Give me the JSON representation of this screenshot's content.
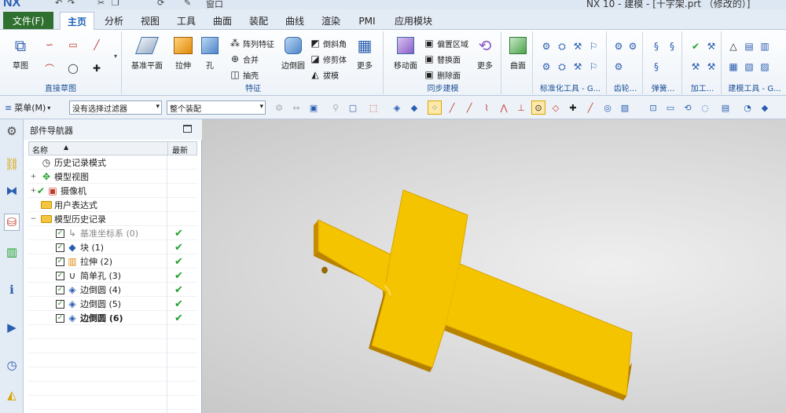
{
  "app": {
    "logo": "NX",
    "window_title": "NX 10 - 建模 - [十字架.prt （修改的）]",
    "window_menu": "窗口"
  },
  "tabs": [
    "文件(F)",
    "主页",
    "分析",
    "视图",
    "工具",
    "曲面",
    "装配",
    "曲线",
    "渲染",
    "PMI",
    "应用模块"
  ],
  "active_tab": "主页",
  "ribbon": {
    "sketch_group": {
      "label": "直接草图",
      "sketch_button": "草图"
    },
    "feature_group": {
      "label": "特征",
      "buttons": [
        "基准平面",
        "拉伸",
        "孔",
        "边倒圆",
        "更多"
      ],
      "small": [
        "阵列特征",
        "合并",
        "抽壳",
        "倒斜角",
        "修剪体",
        "拔模"
      ]
    },
    "sync_group": {
      "label": "同步建模",
      "buttons": [
        "移动面",
        "更多"
      ],
      "small": [
        "偏置区域",
        "替换面",
        "删除面"
      ]
    },
    "surface_button": "曲面",
    "more_groups": [
      "标准化工具 - G...",
      "齿轮...",
      "弹簧...",
      "加工...",
      "建模工具 - G..."
    ]
  },
  "filterbar": {
    "menu_label": "菜单(M)",
    "filter_value": "没有选择过滤器",
    "scope_value": "整个装配"
  },
  "navigator": {
    "title": "部件导航器",
    "col_name": "名称",
    "col_latest": "最新",
    "rows": [
      {
        "label": "历史记录模式",
        "indent": 0,
        "exp": "",
        "check": false,
        "icon": "clock-icon",
        "tick": false,
        "style": ""
      },
      {
        "label": "模型视图",
        "indent": 0,
        "exp": "+",
        "check": false,
        "icon": "model-view-icon",
        "tick": false,
        "style": ""
      },
      {
        "label": "摄像机",
        "indent": 0,
        "exp": "+",
        "check": false,
        "icon": "camera-icon",
        "tick": false,
        "style": ""
      },
      {
        "label": "用户表达式",
        "indent": 0,
        "exp": "",
        "check": false,
        "icon": "folder-icon",
        "tick": false,
        "style": ""
      },
      {
        "label": "模型历史记录",
        "indent": 0,
        "exp": "−",
        "check": false,
        "icon": "folder-open-icon",
        "tick": false,
        "style": ""
      },
      {
        "label": "基准坐标系 (0)",
        "indent": 1,
        "exp": "",
        "check": true,
        "icon": "datum-csys-icon",
        "tick": true,
        "style": "grey"
      },
      {
        "label": "块 (1)",
        "indent": 1,
        "exp": "",
        "check": true,
        "icon": "block-icon",
        "tick": true,
        "style": ""
      },
      {
        "label": "拉伸 (2)",
        "indent": 1,
        "exp": "",
        "check": true,
        "icon": "extrude-icon",
        "tick": true,
        "style": ""
      },
      {
        "label": "简单孔 (3)",
        "indent": 1,
        "exp": "",
        "check": true,
        "icon": "hole-icon",
        "tick": true,
        "style": ""
      },
      {
        "label": "边倒圆 (4)",
        "indent": 1,
        "exp": "",
        "check": true,
        "icon": "edge-blend-icon",
        "tick": true,
        "style": ""
      },
      {
        "label": "边倒圆 (5)",
        "indent": 1,
        "exp": "",
        "check": true,
        "icon": "edge-blend-icon",
        "tick": true,
        "style": ""
      },
      {
        "label": "边倒圆 (6)",
        "indent": 1,
        "exp": "",
        "check": true,
        "icon": "edge-blend-icon",
        "tick": true,
        "style": "bold"
      }
    ]
  },
  "colors": {
    "part": "#f2c200",
    "part_side": "#c08a00",
    "file_tab": "#2f6f2f",
    "check": "#1fa12b"
  }
}
